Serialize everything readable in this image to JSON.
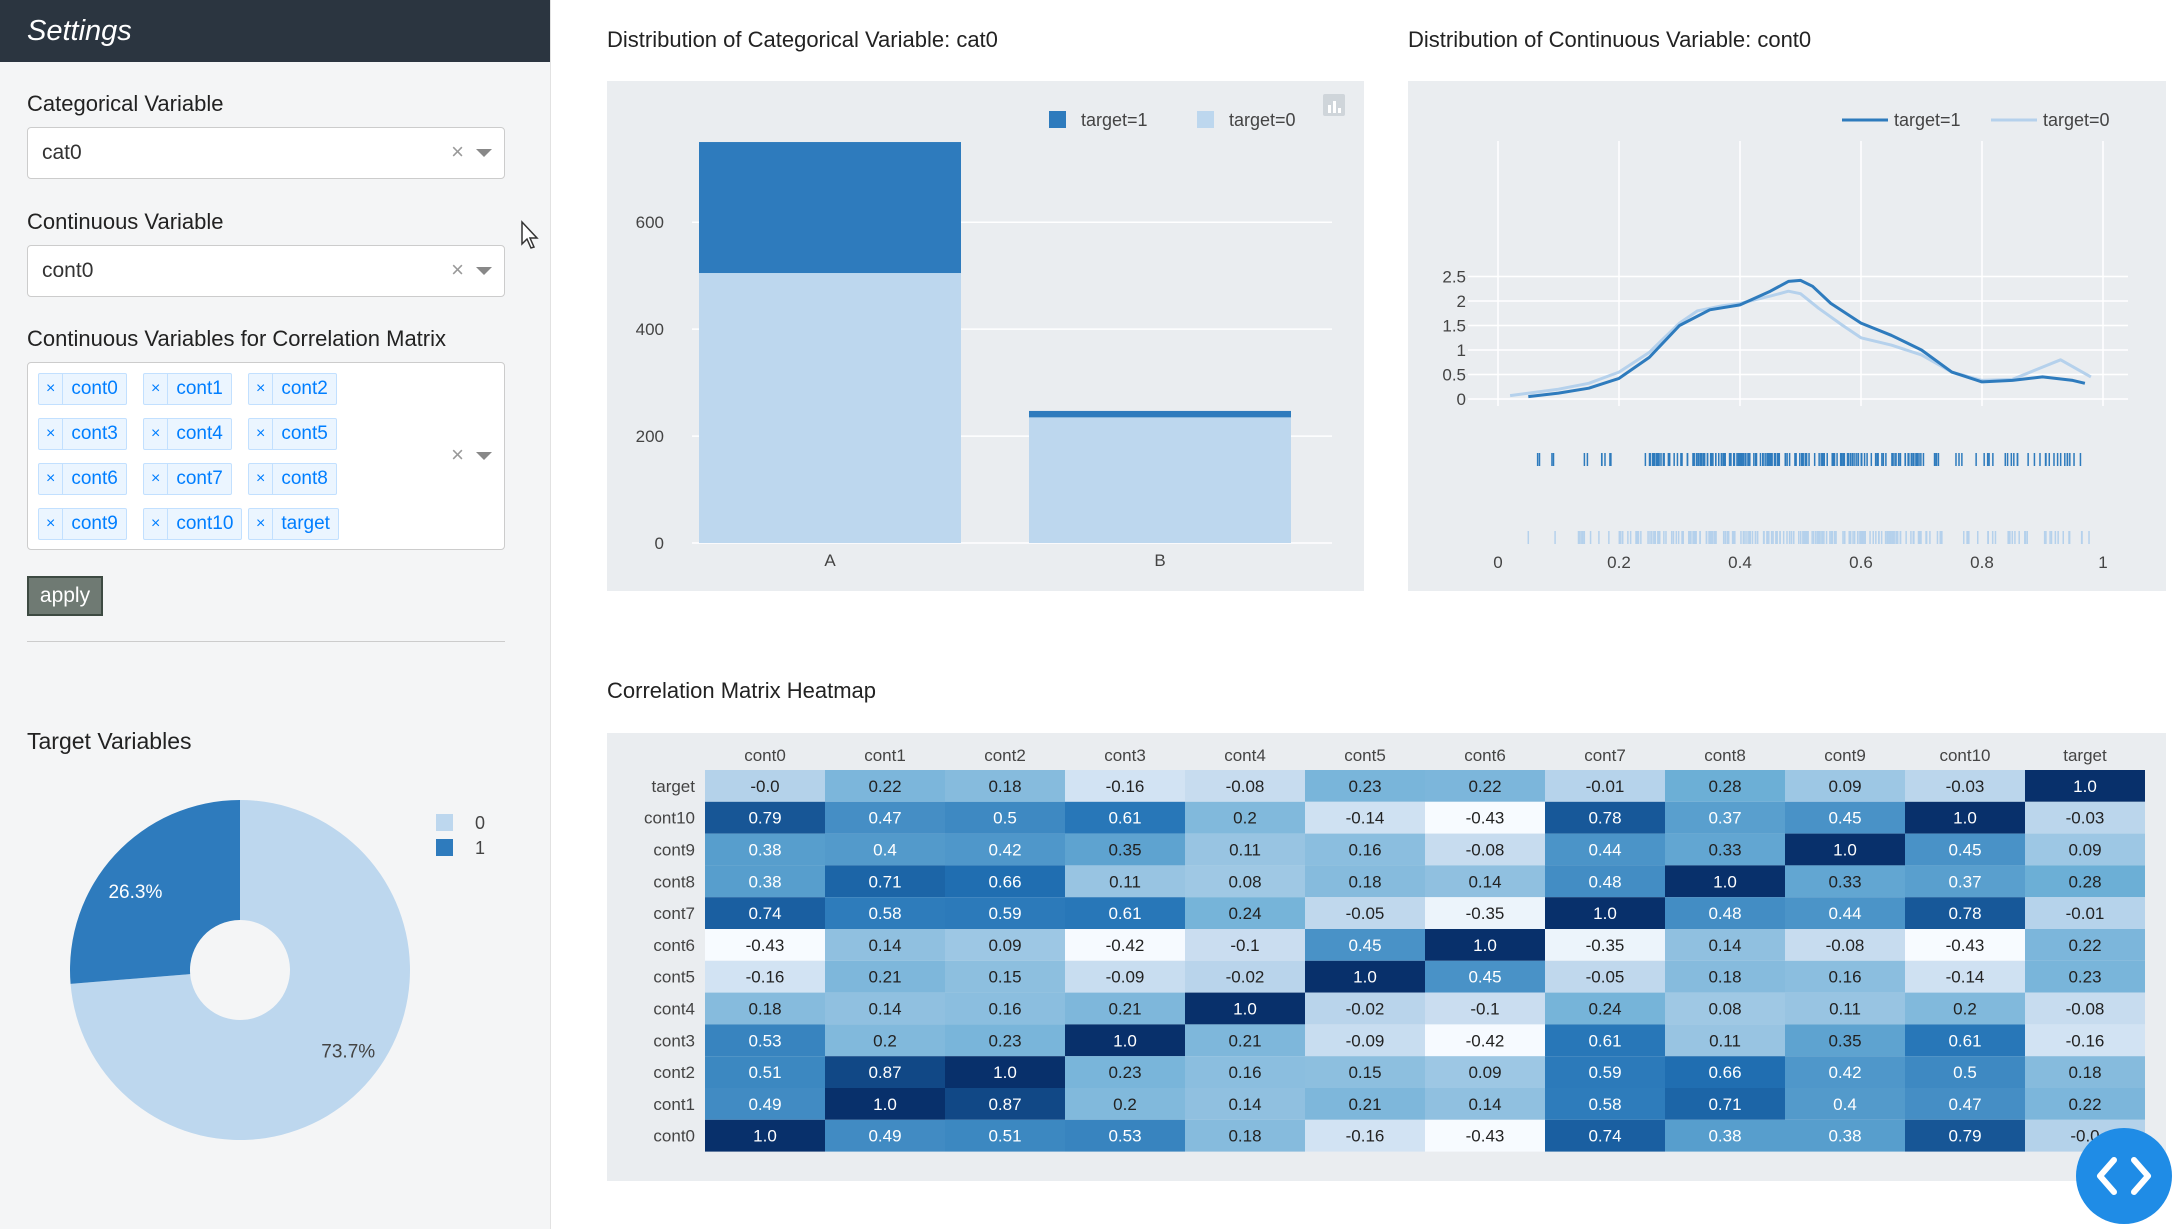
{
  "sidebar": {
    "title": "Settings",
    "categorical_label": "Categorical Variable",
    "categorical_value": "cat0",
    "continuous_label": "Continuous Variable",
    "continuous_value": "cont0",
    "corr_label": "Continuous Variables for Correlation Matrix",
    "corr_tags": [
      "cont0",
      "cont1",
      "cont2",
      "cont3",
      "cont4",
      "cont5",
      "cont6",
      "cont7",
      "cont8",
      "cont9",
      "cont10",
      "target"
    ],
    "clear_glyph": "×",
    "apply_label": "apply",
    "target_title": "Target Variables"
  },
  "pie": {
    "labels": [
      "0",
      "1"
    ],
    "values": [
      73.7,
      26.3
    ],
    "display": [
      "73.7%",
      "26.3%"
    ],
    "colors": [
      "#bdd7ee",
      "#2e7bbd"
    ]
  },
  "bar_panel": {
    "title": "Distribution of Categorical Variable: cat0",
    "chart_data": {
      "type": "bar",
      "stacked": true,
      "categories": [
        "A",
        "B"
      ],
      "series": [
        {
          "name": "target=1",
          "values": [
            245,
            12
          ],
          "color": "#2e7bbd"
        },
        {
          "name": "target=0",
          "values": [
            505,
            235
          ],
          "color": "#bdd7ee"
        }
      ],
      "yticks": [
        0,
        200,
        400,
        600
      ],
      "ylim": [
        0,
        780
      ],
      "legend": "top-right"
    }
  },
  "kde_panel": {
    "title": "Distribution of Continuous Variable: cont0",
    "chart_data": {
      "type": "line",
      "xticks": [
        "0",
        "0.2",
        "0.4",
        "0.6",
        "0.8",
        "1"
      ],
      "yticks": [
        "0",
        "0.5",
        "1",
        "1.5",
        "2",
        "2.5"
      ],
      "xlim": [
        0,
        1
      ],
      "ylim": [
        -0.1,
        2.6
      ],
      "legend": "top-right",
      "series": [
        {
          "name": "target=1",
          "color": "#2e7bbd",
          "x": [
            0.05,
            0.1,
            0.15,
            0.2,
            0.25,
            0.3,
            0.35,
            0.4,
            0.45,
            0.48,
            0.5,
            0.52,
            0.55,
            0.6,
            0.65,
            0.7,
            0.75,
            0.8,
            0.85,
            0.9,
            0.95,
            0.97
          ],
          "y": [
            0.05,
            0.12,
            0.22,
            0.42,
            0.85,
            1.5,
            1.82,
            1.92,
            2.2,
            2.4,
            2.42,
            2.3,
            1.95,
            1.55,
            1.3,
            1.0,
            0.55,
            0.35,
            0.38,
            0.45,
            0.38,
            0.32
          ]
        },
        {
          "name": "target=0",
          "color": "#b5d1ec",
          "x": [
            0.02,
            0.1,
            0.15,
            0.2,
            0.25,
            0.3,
            0.33,
            0.37,
            0.4,
            0.45,
            0.48,
            0.5,
            0.53,
            0.57,
            0.6,
            0.65,
            0.7,
            0.75,
            0.8,
            0.85,
            0.9,
            0.93,
            0.98
          ],
          "y": [
            0.07,
            0.2,
            0.32,
            0.55,
            0.95,
            1.55,
            1.8,
            1.9,
            1.95,
            2.1,
            2.2,
            2.15,
            1.85,
            1.5,
            1.25,
            1.1,
            0.9,
            0.55,
            0.38,
            0.4,
            0.65,
            0.8,
            0.45
          ]
        }
      ]
    }
  },
  "heatmap_panel": {
    "title": "Correlation Matrix Heatmap",
    "chart_data": {
      "type": "heatmap",
      "x_labels": [
        "cont0",
        "cont1",
        "cont2",
        "cont3",
        "cont4",
        "cont5",
        "cont6",
        "cont7",
        "cont8",
        "cont9",
        "cont10",
        "target"
      ],
      "y_labels": [
        "target",
        "cont10",
        "cont9",
        "cont8",
        "cont7",
        "cont6",
        "cont5",
        "cont4",
        "cont3",
        "cont2",
        "cont1",
        "cont0"
      ],
      "values": [
        [
          "-0.0",
          "0.22",
          "0.18",
          "-0.16",
          "-0.08",
          "0.23",
          "0.22",
          "-0.01",
          "0.28",
          "0.09",
          "-0.03",
          "1.0"
        ],
        [
          "0.79",
          "0.47",
          "0.5",
          "0.61",
          "0.2",
          "-0.14",
          "-0.43",
          "0.78",
          "0.37",
          "0.45",
          "1.0",
          "-0.03"
        ],
        [
          "0.38",
          "0.4",
          "0.42",
          "0.35",
          "0.11",
          "0.16",
          "-0.08",
          "0.44",
          "0.33",
          "1.0",
          "0.45",
          "0.09"
        ],
        [
          "0.38",
          "0.71",
          "0.66",
          "0.11",
          "0.08",
          "0.18",
          "0.14",
          "0.48",
          "1.0",
          "0.33",
          "0.37",
          "0.28"
        ],
        [
          "0.74",
          "0.58",
          "0.59",
          "0.61",
          "0.24",
          "-0.05",
          "-0.35",
          "1.0",
          "0.48",
          "0.44",
          "0.78",
          "-0.01"
        ],
        [
          "-0.43",
          "0.14",
          "0.09",
          "-0.42",
          "-0.1",
          "0.45",
          "1.0",
          "-0.35",
          "0.14",
          "-0.08",
          "-0.43",
          "0.22"
        ],
        [
          "-0.16",
          "0.21",
          "0.15",
          "-0.09",
          "-0.02",
          "1.0",
          "0.45",
          "-0.05",
          "0.18",
          "0.16",
          "-0.14",
          "0.23"
        ],
        [
          "0.18",
          "0.14",
          "0.16",
          "0.21",
          "1.0",
          "-0.02",
          "-0.1",
          "0.24",
          "0.08",
          "0.11",
          "0.2",
          "-0.08"
        ],
        [
          "0.53",
          "0.2",
          "0.23",
          "1.0",
          "0.21",
          "-0.09",
          "-0.42",
          "0.61",
          "0.11",
          "0.35",
          "0.61",
          "-0.16"
        ],
        [
          "0.51",
          "0.87",
          "1.0",
          "0.23",
          "0.16",
          "0.15",
          "0.09",
          "0.59",
          "0.66",
          "0.42",
          "0.5",
          "0.18"
        ],
        [
          "0.49",
          "1.0",
          "0.87",
          "0.2",
          "0.14",
          "0.21",
          "0.14",
          "0.58",
          "0.71",
          "0.4",
          "0.47",
          "0.22"
        ],
        [
          "1.0",
          "0.49",
          "0.51",
          "0.53",
          "0.18",
          "-0.16",
          "-0.43",
          "0.74",
          "0.38",
          "0.38",
          "0.79",
          "-0.0"
        ]
      ]
    }
  },
  "icons": {
    "cursor": "mouse-pointer-icon",
    "code": "code-brackets-icon",
    "modebar": "bar-chart-icon"
  }
}
